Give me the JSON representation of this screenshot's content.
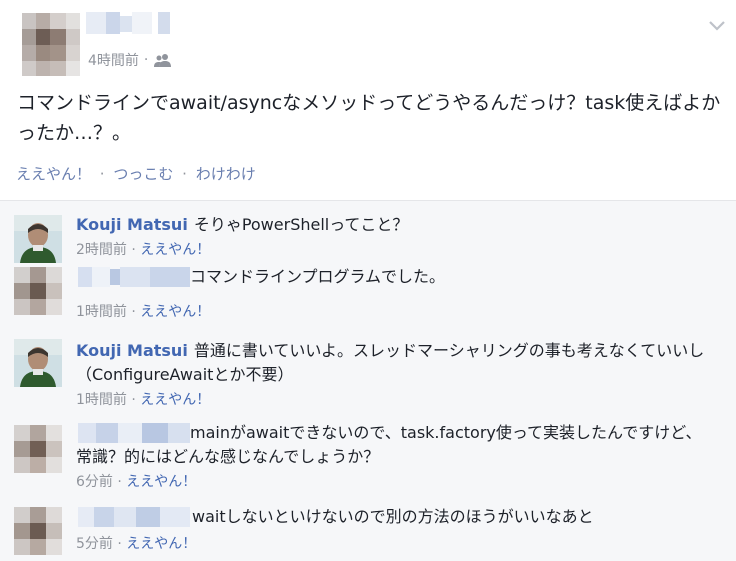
{
  "post": {
    "time": "4時間前",
    "separator": "·",
    "text": "コマンドラインでawait/asyncなメソッドってどうやるんだっけ？task使えばよかったか…？。",
    "actions": [
      "ええやん！",
      "つっこむ",
      "わけわけ"
    ],
    "privacy_icon": "friends-icon",
    "menu_icon": "chevron-down-icon"
  },
  "comments": [
    {
      "author": "Kouji Matsui",
      "text": "そりゃPowerShellってこと？",
      "time": "2時間前",
      "like": "ええやん！"
    },
    {
      "author": "",
      "text": "コマンドラインプログラムでした。",
      "time": "1時間前",
      "like": "ええやん！"
    },
    {
      "author": "Kouji Matsui",
      "text": "普通に書いていいよ。スレッドマーシャリングの事も考えなくていいし（ConfigureAwaitとか不要）",
      "time": "1時間前",
      "like": "ええやん！"
    },
    {
      "author": "",
      "text": "mainがawaitできないので、task.factory使って実装したんですけど、常識？的にはどんな感じなんでしょうか？",
      "time": "6分前",
      "like": "ええやん！"
    },
    {
      "author": "",
      "text": "waitしないといけないので別の方法のほうがいいなあと",
      "time": "5分前",
      "like": "ええやん！"
    }
  ],
  "separator": "·",
  "colors": {
    "link": "#4267b2",
    "meta": "#90949c",
    "comment_bg": "#f6f7f9"
  }
}
